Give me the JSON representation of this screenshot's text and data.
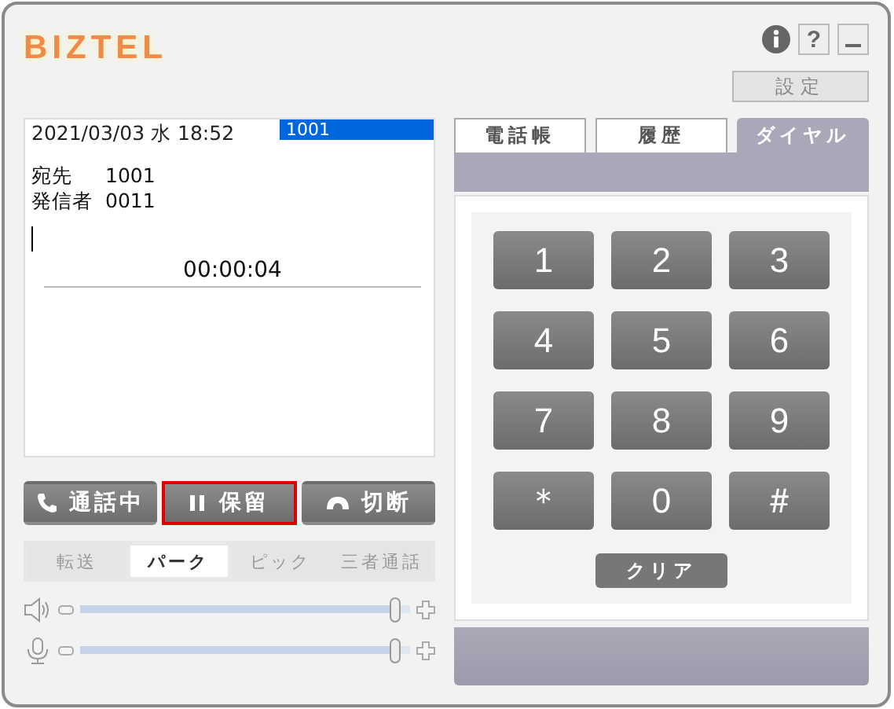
{
  "header": {
    "logo": "BIZTEL",
    "help_button": "?",
    "settings_button": "設定"
  },
  "call": {
    "date": "2021/03/03 水 18:52",
    "line": "1001",
    "fields": [
      {
        "label": "宛先",
        "value": "1001"
      },
      {
        "label": "発信者",
        "value": "0011"
      }
    ],
    "timer": "00:00:04"
  },
  "call_buttons": [
    {
      "label": "通話中",
      "kind": "talk",
      "highlighted": false
    },
    {
      "label": "保留",
      "kind": "hold",
      "highlighted": true
    },
    {
      "label": "切断",
      "kind": "disconnect",
      "highlighted": false
    }
  ],
  "transfer_tabs": [
    {
      "label": "転送",
      "selected": false,
      "disabled": true
    },
    {
      "label": "パーク",
      "selected": true,
      "disabled": false
    },
    {
      "label": "ピック",
      "selected": false,
      "disabled": true
    },
    {
      "label": "三者通話",
      "selected": false,
      "disabled": true
    }
  ],
  "volume": [
    {
      "kind": "speaker",
      "level": 0.97
    },
    {
      "kind": "mic",
      "level": 0.97
    }
  ],
  "tabs": [
    {
      "label": "電話帳",
      "selected": false
    },
    {
      "label": "履歴",
      "selected": false
    },
    {
      "label": "ダイヤル",
      "selected": true
    }
  ],
  "keypad": {
    "keys": [
      "1",
      "2",
      "3",
      "4",
      "5",
      "6",
      "7",
      "8",
      "9",
      "＊",
      "0",
      "＃"
    ],
    "clear_button": "クリア"
  }
}
